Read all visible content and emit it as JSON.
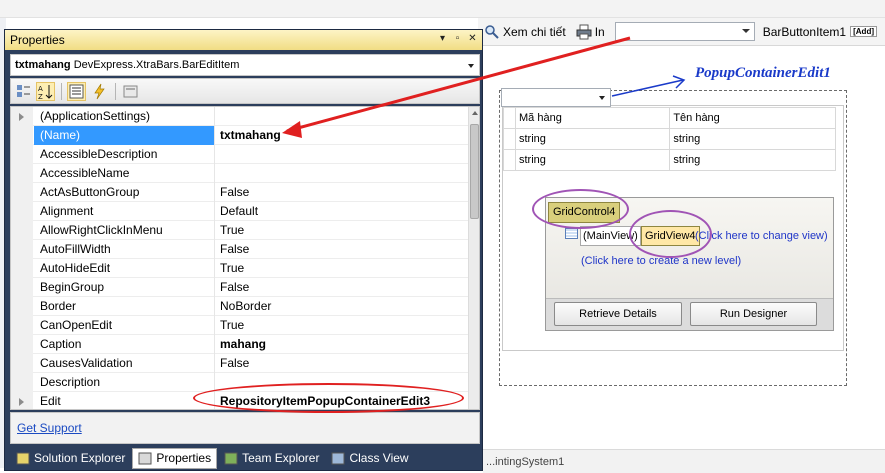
{
  "toolbar": {
    "view_detail_label": "Xem chi tiết",
    "print_label": "In",
    "combo_value": "",
    "bar_button_label": "BarButtonItem1",
    "add_badge": "[Add]"
  },
  "designer": {
    "popup_title": "PopupContainerEdit1",
    "grid_headers": [
      "Mã hàng",
      "Tên hàng"
    ],
    "grid_rows": [
      [
        "string",
        "string"
      ],
      [
        "string",
        "string"
      ]
    ],
    "grid_control_label": "GridControl4",
    "main_view_label": "(MainView)",
    "grid_view_label": "GridView4",
    "change_view_link": "(Click here to change view)",
    "new_level_link": "(Click here to create a new level)",
    "retrieve_details_button": "Retrieve Details",
    "run_designer_button": "Run Designer",
    "bottom_text": "...intingSystem1"
  },
  "properties": {
    "title": "Properties",
    "object_name": "txtmahang",
    "object_type": "DevExpress.XtraBars.BarEditItem",
    "rows": [
      {
        "name": "(ApplicationSettings)",
        "value": ""
      },
      {
        "name": "(Name)",
        "value": "txtmahang"
      },
      {
        "name": "AccessibleDescription",
        "value": ""
      },
      {
        "name": "AccessibleName",
        "value": ""
      },
      {
        "name": "ActAsButtonGroup",
        "value": "False"
      },
      {
        "name": "Alignment",
        "value": "Default"
      },
      {
        "name": "AllowRightClickInMenu",
        "value": "True"
      },
      {
        "name": "AutoFillWidth",
        "value": "False"
      },
      {
        "name": "AutoHideEdit",
        "value": "True"
      },
      {
        "name": "BeginGroup",
        "value": "False"
      },
      {
        "name": "Border",
        "value": "NoBorder"
      },
      {
        "name": "CanOpenEdit",
        "value": "True"
      },
      {
        "name": "Caption",
        "value": "mahang"
      },
      {
        "name": "CausesValidation",
        "value": "False"
      },
      {
        "name": "Description",
        "value": ""
      },
      {
        "name": "Edit",
        "value": "RepositoryItemPopupContainerEdit3"
      }
    ],
    "get_support": "Get Support"
  },
  "tabs": [
    {
      "label": "Solution Explorer",
      "icon": "solution-explorer-icon"
    },
    {
      "label": "Properties",
      "icon": "properties-icon"
    },
    {
      "label": "Team Explorer",
      "icon": "team-explorer-icon"
    },
    {
      "label": "Class View",
      "icon": "class-view-icon"
    }
  ],
  "colors": {
    "selection": "#3399ff",
    "annotation_red": "#e02020",
    "annotation_purple": "#a054b5",
    "annotation_blue": "#1a3ac9"
  }
}
